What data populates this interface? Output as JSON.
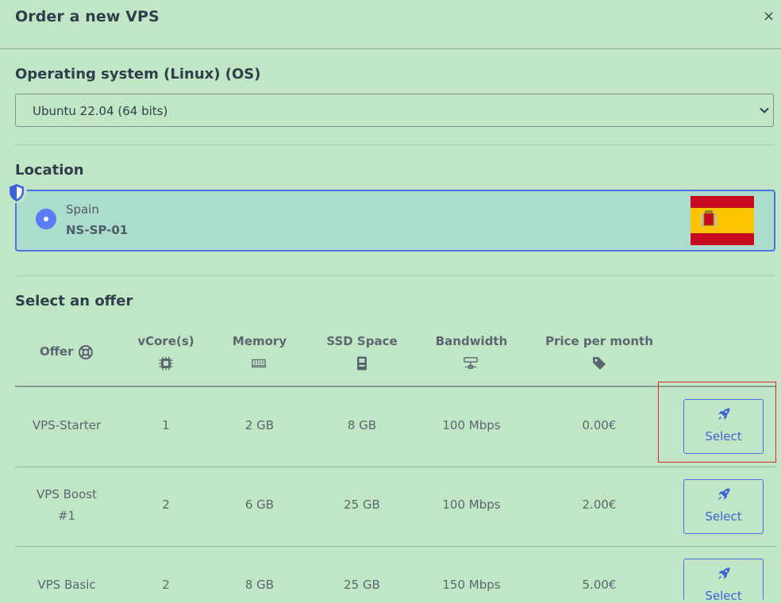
{
  "dialog": {
    "title": "Order a new VPS",
    "close_symbol": "×"
  },
  "os": {
    "heading": "Operating system (Linux) (OS)",
    "selected": "Ubuntu 22.04 (64 bits)"
  },
  "location": {
    "heading": "Location",
    "country": "Spain",
    "code": "NS-SP-01"
  },
  "offers": {
    "heading": "Select an offer",
    "columns": [
      "Offer",
      "vCore(s)",
      "Memory",
      "SSD Space",
      "Bandwidth",
      "Price per month"
    ],
    "rows": [
      {
        "name": "VPS-Starter",
        "name_line2": "",
        "vcores": "1",
        "memory": "2 GB",
        "ssd": "8 GB",
        "bandwidth": "100 Mbps",
        "price": "0.00€",
        "button": "Select"
      },
      {
        "name": "VPS Boost",
        "name_line2": "#1",
        "vcores": "2",
        "memory": "6 GB",
        "ssd": "25 GB",
        "bandwidth": "100 Mbps",
        "price": "2.00€",
        "button": "Select"
      },
      {
        "name": "VPS Basic",
        "name_line2": "",
        "vcores": "2",
        "memory": "8 GB",
        "ssd": "25 GB",
        "bandwidth": "150 Mbps",
        "price": "5.00€",
        "button": "Select"
      }
    ]
  },
  "icons": {
    "offer_column": "lifebuoy-icon",
    "vcore_column": "cpu-icon",
    "memory_column": "memory-icon",
    "ssd_column": "ssd-icon",
    "bandwidth_column": "network-icon",
    "price_column": "tag-icon",
    "select_button": "rocket-icon",
    "location_badge": "shield-icon",
    "os_dropdown": "chevron-down-icon"
  },
  "colors": {
    "background": "#c1e6c5",
    "accent": "#4a72e0",
    "highlight": "#e0262a"
  }
}
